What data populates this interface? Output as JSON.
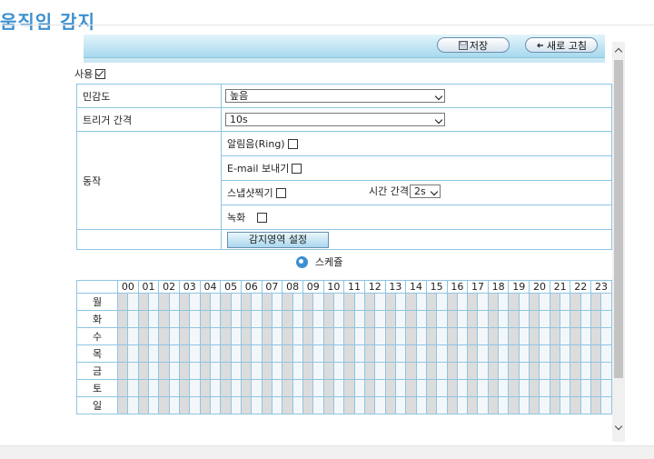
{
  "page": {
    "title": "움직임 감지"
  },
  "toolbar": {
    "save_label": "저장",
    "refresh_label": "새로 고침"
  },
  "enable": {
    "label": "사용",
    "checked": true
  },
  "settings": {
    "sensitivity": {
      "label": "민감도",
      "value": "높음"
    },
    "trigger_interval": {
      "label": "트리거 간격",
      "value": "10s"
    },
    "action": {
      "label": "동작",
      "ring_label": "알림음(Ring)",
      "email_label": "E-mail 보내기",
      "snapshot_label": "스냅샷찍기",
      "interval_label": "시간 간격",
      "interval_value": "2s",
      "record_label": "녹화"
    },
    "area_button_label": "감지영역 설정"
  },
  "schedule": {
    "title": "스케쥴",
    "hours": [
      "00",
      "01",
      "02",
      "03",
      "04",
      "05",
      "06",
      "07",
      "08",
      "09",
      "10",
      "11",
      "12",
      "13",
      "14",
      "15",
      "16",
      "17",
      "18",
      "19",
      "20",
      "21",
      "22",
      "23"
    ],
    "days": [
      "월",
      "화",
      "수",
      "목",
      "금",
      "토",
      "일"
    ]
  },
  "colors": {
    "accent": "#3d8fcf",
    "toolbar": "#a6d9ee",
    "grid_border": "#8ec5e2",
    "slot_dark": "#dcdcdc",
    "slot_light": "#f4f7f9"
  }
}
